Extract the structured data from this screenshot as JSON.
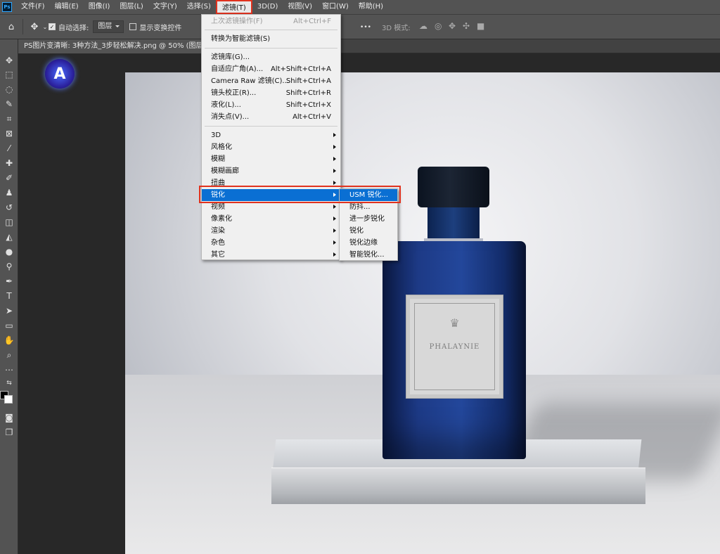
{
  "app": {
    "logo": "Ps"
  },
  "menubar": {
    "items": [
      "文件(F)",
      "编辑(E)",
      "图像(I)",
      "图层(L)",
      "文字(Y)",
      "选择(S)",
      "滤镜(T)",
      "3D(D)",
      "视图(V)",
      "窗口(W)",
      "帮助(H)"
    ]
  },
  "options_bar": {
    "auto_select_label": "自动选择:",
    "auto_select_target": "图层",
    "show_transform_label": "显示变换控件",
    "mode_3d_label": "3D 模式:",
    "more": "•••"
  },
  "document": {
    "tab_title": "PS图片变清晰: 3种方法_3步轻松解决.png @ 50% (图层"
  },
  "filter_menu": {
    "last_filter": {
      "label": "上次滤镜操作(F)",
      "shortcut": "Alt+Ctrl+F"
    },
    "convert_smart": "转换为智能滤镜(S)",
    "group2": [
      {
        "label": "滤镜库(G)...",
        "shortcut": ""
      },
      {
        "label": "自适应广角(A)...",
        "shortcut": "Alt+Shift+Ctrl+A"
      },
      {
        "label": "Camera Raw 滤镜(C)...",
        "shortcut": "Shift+Ctrl+A"
      },
      {
        "label": "镜头校正(R)...",
        "shortcut": "Shift+Ctrl+R"
      },
      {
        "label": "液化(L)...",
        "shortcut": "Shift+Ctrl+X"
      },
      {
        "label": "消失点(V)...",
        "shortcut": "Alt+Ctrl+V"
      }
    ],
    "submenus": [
      "3D",
      "风格化",
      "模糊",
      "模糊画廊",
      "扭曲",
      "锐化",
      "视频",
      "像素化",
      "渲染",
      "杂色",
      "其它"
    ],
    "highlighted": "锐化"
  },
  "sharpen_submenu": {
    "items": [
      "USM 锐化...",
      "防抖...",
      "进一步锐化",
      "锐化",
      "锐化边缘",
      "智能锐化..."
    ],
    "highlighted": "USM 锐化..."
  },
  "product": {
    "brand": "PHALAYNIE"
  },
  "watermark": {
    "letter": "A"
  },
  "colors": {
    "highlight": "#0a6fd3",
    "annotation": "#e0321e"
  }
}
